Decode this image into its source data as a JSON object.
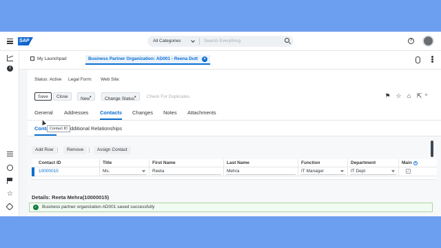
{
  "shell": {
    "logo": "SAP",
    "category": "All Categories",
    "search_placeholder": "Search Everything",
    "help": "?"
  },
  "tabs_bar": {
    "home_label": "My Launchpad",
    "active_label": "Business Partner Organization: AD001 - Reena Dutt",
    "close": "×"
  },
  "header": {
    "status_label": "Status:",
    "status_value": "Active",
    "legal_form_label": "Legal Form:",
    "website_label": "Web Site:"
  },
  "actions": {
    "save": "Save",
    "close": "Close",
    "new": "New",
    "change_status": "Change Status",
    "check_duplicates": "Check For Duplicates"
  },
  "main_tabs": [
    "General",
    "Addresses",
    "Contacts",
    "Changes",
    "Notes",
    "Attachments"
  ],
  "sub_tabs": [
    "Contacts",
    "Additional Relationships"
  ],
  "toolbar": {
    "add_row": "Add Row",
    "remove": "Remove",
    "assign_contact": "Assign Contact"
  },
  "tooltip": "Contact ID",
  "table": {
    "columns": [
      "Contact ID",
      "Title",
      "First Name",
      "Last Name",
      "Function",
      "Department",
      "Main"
    ],
    "rows": [
      {
        "contact_id": "10000015",
        "title": "Ms.",
        "first_name": "Reeta",
        "last_name": "Mehra",
        "function": "IT Manager",
        "department": "IT Dept",
        "main": "✓"
      }
    ]
  },
  "details_title": "Details: Reeta Mehra(10000015)",
  "toast": "Business partner organization AD001 saved successfully",
  "colors": {
    "brand": "#0a6ed1",
    "success": "#107e3e",
    "backdrop": "#6d9ff0"
  }
}
